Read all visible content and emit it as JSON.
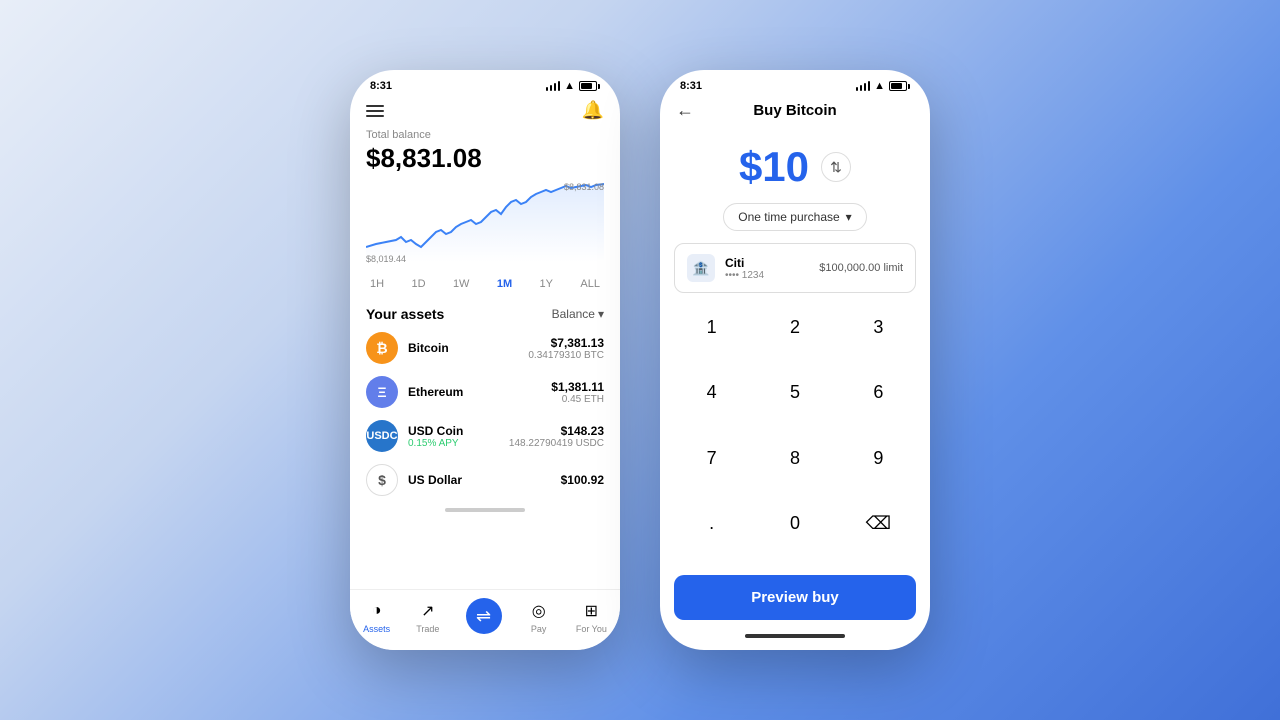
{
  "background": {
    "gradient_start": "#e8eef8",
    "gradient_end": "#4070d8"
  },
  "left_phone": {
    "status_bar": {
      "time": "8:31"
    },
    "header": {
      "hamburger_label": "menu",
      "bell_label": "notifications"
    },
    "balance": {
      "label": "Total balance",
      "amount": "$8,831.08"
    },
    "chart": {
      "max_label": "$8,831.08",
      "min_label": "$8,019.44"
    },
    "time_filters": [
      {
        "label": "1H",
        "active": false
      },
      {
        "label": "1D",
        "active": false
      },
      {
        "label": "1W",
        "active": false
      },
      {
        "label": "1M",
        "active": true
      },
      {
        "label": "1Y",
        "active": false
      },
      {
        "label": "ALL",
        "active": false
      }
    ],
    "assets_section": {
      "title": "Your assets",
      "filter_label": "Balance"
    },
    "assets": [
      {
        "name": "Bitcoin",
        "symbol": "BTC",
        "icon": "₿",
        "icon_class": "btc",
        "usd_value": "$7,381.13",
        "crypto_value": "0.34179310 BTC",
        "sub": ""
      },
      {
        "name": "Ethereum",
        "symbol": "ETH",
        "icon": "Ξ",
        "icon_class": "eth",
        "usd_value": "$1,381.11",
        "crypto_value": "0.45 ETH",
        "sub": ""
      },
      {
        "name": "USD Coin",
        "symbol": "USDC",
        "icon": "$",
        "icon_class": "usdc",
        "usd_value": "$148.23",
        "crypto_value": "148.22790419 USDC",
        "sub": "0.15% APY"
      },
      {
        "name": "US Dollar",
        "symbol": "USD",
        "icon": "$",
        "icon_class": "usd",
        "usd_value": "$100.92",
        "crypto_value": "",
        "sub": ""
      }
    ],
    "bottom_nav": [
      {
        "label": "Assets",
        "active": false,
        "icon": "◑"
      },
      {
        "label": "Trade",
        "active": false,
        "icon": "↗"
      },
      {
        "label": "",
        "active": true,
        "icon": "↔"
      },
      {
        "label": "Pay",
        "active": false,
        "icon": "◎"
      },
      {
        "label": "For You",
        "active": false,
        "icon": "⊞"
      }
    ]
  },
  "right_phone": {
    "status_bar": {
      "time": "8:31"
    },
    "header": {
      "back_label": "←",
      "title": "Buy Bitcoin"
    },
    "amount": {
      "value": "$10",
      "swap_icon": "⇅"
    },
    "purchase_type": {
      "label": "One time purchase",
      "dropdown_arrow": "▾"
    },
    "payment_method": {
      "bank_name": "Citi",
      "bank_number": "•••• 1234",
      "limit": "$100,000.00 limit"
    },
    "numpad": {
      "keys": [
        "1",
        "2",
        "3",
        "4",
        "5",
        "6",
        "7",
        "8",
        "9",
        ".",
        "0",
        "⌫"
      ]
    },
    "preview_button": {
      "label": "Preview buy"
    }
  }
}
